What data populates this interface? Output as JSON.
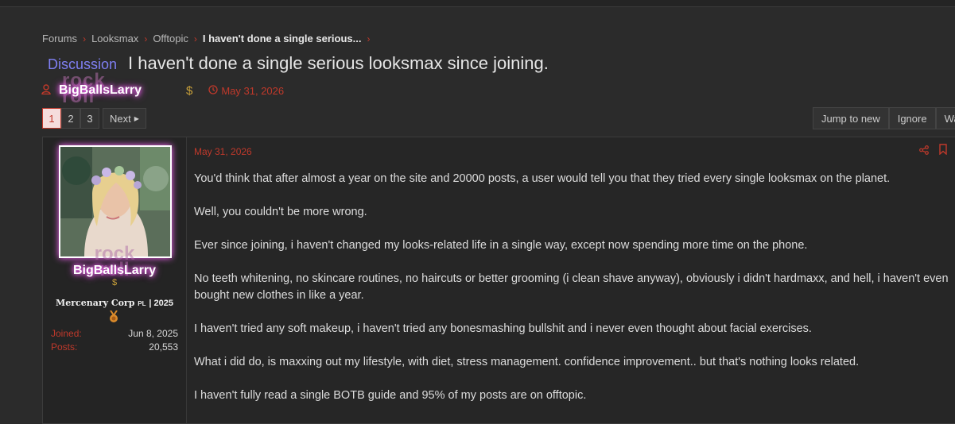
{
  "breadcrumb": [
    "Forums",
    "Looksmax",
    "Offtopic",
    "I haven't done a single serious..."
  ],
  "thread": {
    "prefix": "Discussion",
    "title": "I haven't done a single serious looksmax since joining.",
    "author": "BigBallsLarry",
    "author_bg_text_1": "rock",
    "author_bg_text_2": "roll",
    "date": "May 31, 2026"
  },
  "pagination": {
    "pages": [
      "1",
      "2",
      "3"
    ],
    "current": "1",
    "next_label": "Next"
  },
  "actions": [
    "Jump to new",
    "Ignore",
    "Wa"
  ],
  "post": {
    "date": "May 31, 2026",
    "user": {
      "name": "BigBallsLarry",
      "rank": "Mercenary Corp",
      "rank_tag": "PL",
      "rank_year": "| 2025",
      "joined_label": "Joined:",
      "joined": "Jun 8, 2025",
      "posts_label": "Posts:",
      "posts": "20,553"
    },
    "paragraphs": [
      "You'd think that after almost a year on the site and 20000 posts, a user would tell you that they tried every single looksmax on the planet.",
      "Well, you couldn't be more wrong.",
      "Ever since joining, i haven't changed my looks-related life in a single way, except now spending more time on the phone.",
      "No teeth whitening, no skincare routines, no haircuts or better grooming (i clean shave anyway), obviously i didn't hardmaxx, and hell, i haven't even bought new clothes in like a year.",
      "I haven't tried any soft makeup, i haven't tried any bonesmashing bullshit and i never even thought about facial exercises.",
      "What i did do, is maxxing out my lifestyle, with diet, stress management. confidence improvement.. but that's nothing looks related.",
      "I haven't fully read a single BOTB guide and 95% of my posts are on offtopic."
    ]
  },
  "colors": {
    "accent": "#c0392b",
    "prefix": "#7f7ff2",
    "glow": "#ff66ff"
  }
}
